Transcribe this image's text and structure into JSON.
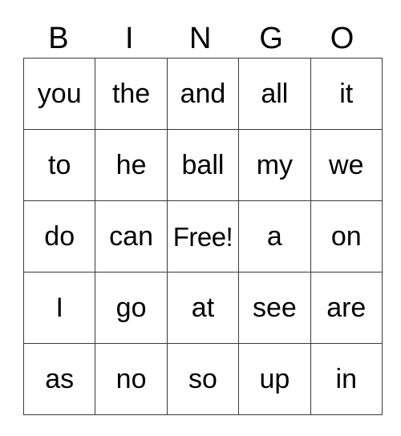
{
  "card": {
    "headers": [
      "B",
      "I",
      "N",
      "G",
      "O"
    ],
    "rows": [
      {
        "cells": [
          {
            "text": "you",
            "free": false
          },
          {
            "text": "the",
            "free": false
          },
          {
            "text": "and",
            "free": false
          },
          {
            "text": "all",
            "free": false
          },
          {
            "text": "it",
            "free": false
          }
        ]
      },
      {
        "cells": [
          {
            "text": "to",
            "free": false
          },
          {
            "text": "he",
            "free": false
          },
          {
            "text": "ball",
            "free": false
          },
          {
            "text": "my",
            "free": false
          },
          {
            "text": "we",
            "free": false
          }
        ]
      },
      {
        "cells": [
          {
            "text": "do",
            "free": false
          },
          {
            "text": "can",
            "free": false
          },
          {
            "text": "Free!",
            "free": true
          },
          {
            "text": "a",
            "free": false
          },
          {
            "text": "on",
            "free": false
          }
        ]
      },
      {
        "cells": [
          {
            "text": "I",
            "free": false
          },
          {
            "text": "go",
            "free": false
          },
          {
            "text": "at",
            "free": false
          },
          {
            "text": "see",
            "free": false
          },
          {
            "text": "are",
            "free": false
          }
        ]
      },
      {
        "cells": [
          {
            "text": "as",
            "free": false
          },
          {
            "text": "no",
            "free": false
          },
          {
            "text": "so",
            "free": false
          },
          {
            "text": "up",
            "free": false
          },
          {
            "text": "in",
            "free": false
          }
        ]
      }
    ]
  },
  "colors": {
    "background": "#ffffff",
    "text": "#000000",
    "border": "#3a3a3a"
  }
}
